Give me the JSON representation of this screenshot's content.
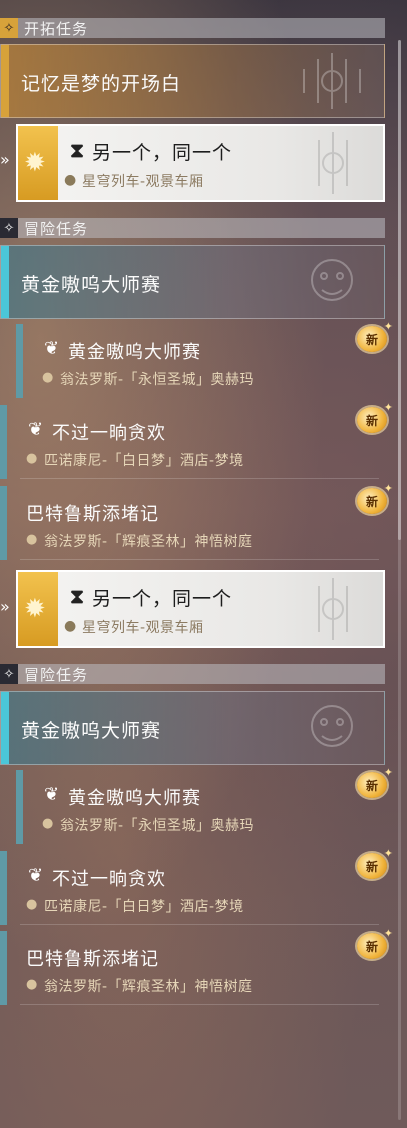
{
  "sections": {
    "trailblaze": {
      "label": "开拓任务",
      "icon": "trailblaze-star-icon"
    },
    "adventure": {
      "label": "冒险任务",
      "icon": "adventure-star-icon"
    }
  },
  "trailblaze_chapter": {
    "title": "记忆是梦的开场白",
    "accent": "#d7a23a"
  },
  "active_quest": {
    "title": "另一个，同一个",
    "location": "星穹列车-观景车厢",
    "accent": "#f2c24e"
  },
  "adventure_chapter": {
    "title": "黄金嗷呜大师赛",
    "accent": "#4bc6d8"
  },
  "quests": [
    {
      "title": "黄金嗷呜大师赛",
      "location": "翁法罗斯-「永恒圣城」奥赫玛",
      "badge": "新"
    },
    {
      "title": "不过一晌贪欢",
      "location": "匹诺康尼-「白日梦」酒店-梦境",
      "badge": "新"
    },
    {
      "title": "巴特鲁斯添堵记",
      "location": "翁法罗斯-「辉痕圣林」神悟树庭",
      "badge": "新"
    }
  ],
  "colors": {
    "quest_bar": "#5f9aa6",
    "badge": "#f0b33a"
  }
}
